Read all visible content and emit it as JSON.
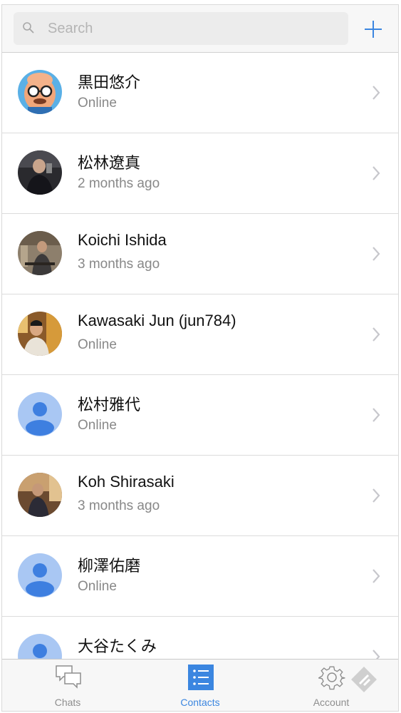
{
  "search": {
    "placeholder": "Search"
  },
  "contacts": [
    {
      "name": "黒田悠介",
      "status": "Online",
      "avatar": "avatar-cartoon"
    },
    {
      "name": "松林遼真",
      "status": "2 months ago",
      "avatar": "avatar-photo"
    },
    {
      "name": "Koichi Ishida",
      "status": "3 months ago",
      "avatar": "avatar-photo"
    },
    {
      "name": "Kawasaki Jun (jun784)",
      "status": "Online",
      "avatar": "avatar-photo"
    },
    {
      "name": "松村雅代",
      "status": "Online",
      "avatar": "avatar-default"
    },
    {
      "name": "Koh Shirasaki",
      "status": "3 months ago",
      "avatar": "avatar-photo"
    },
    {
      "name": "柳澤佑磨",
      "status": "Online",
      "avatar": "avatar-default"
    },
    {
      "name": "大谷たくみ",
      "status": "",
      "avatar": "avatar-default"
    }
  ],
  "tabs": [
    {
      "label": "Chats",
      "icon": "chat-bubbles-icon",
      "active": false
    },
    {
      "label": "Contacts",
      "icon": "contacts-list-icon",
      "active": true
    },
    {
      "label": "Account",
      "icon": "gear-icon",
      "active": false
    }
  ],
  "colors": {
    "accent": "#3b86e0",
    "default_avatar_bg": "#a9c7f3",
    "default_avatar_fg": "#3e7fe0"
  }
}
